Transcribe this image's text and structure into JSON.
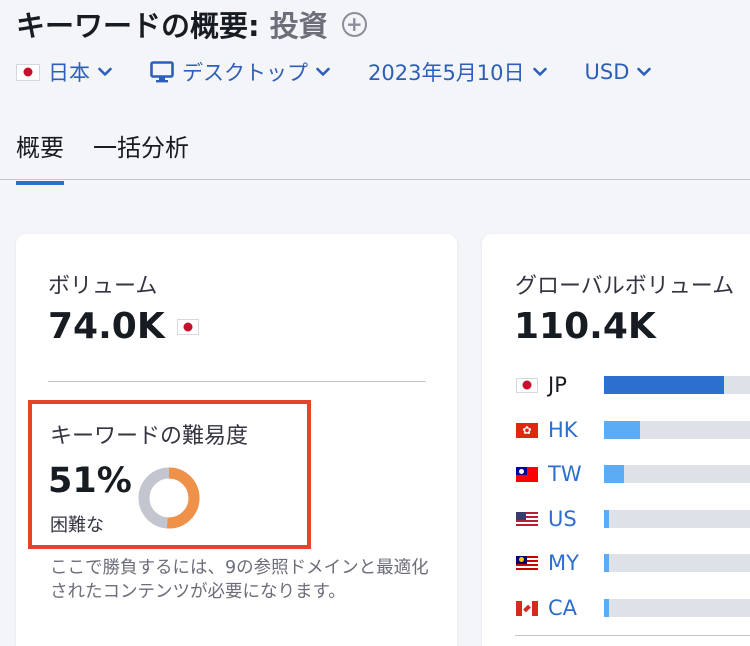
{
  "header": {
    "title_prefix": "キーワードの概要:",
    "keyword": "投資"
  },
  "filters": {
    "database": "日本",
    "device": "デスクトップ",
    "date": "2023年5月10日",
    "currency": "USD"
  },
  "tabs": [
    {
      "label": "概要",
      "active": true
    },
    {
      "label": "一括分析",
      "active": false
    }
  ],
  "volume": {
    "label": "ボリューム",
    "value": "74.0K"
  },
  "difficulty": {
    "label": "キーワードの難易度",
    "value": "51%",
    "percent": 51,
    "rating": "困難な",
    "description": "ここで勝負するには、9の参照ドメインと最適化されたコンテンツが必要になります。"
  },
  "global_volume": {
    "label": "グローバルボリューム",
    "value": "110.4K",
    "countries": [
      {
        "code": "JP",
        "share": 0.8,
        "color": "#2d6fce"
      },
      {
        "code": "HK",
        "share": 0.24,
        "color": "#5cacf5"
      },
      {
        "code": "TW",
        "share": 0.13,
        "color": "#5cacf5"
      },
      {
        "code": "US",
        "share": 0.03,
        "color": "#5cacf5"
      },
      {
        "code": "MY",
        "share": 0.03,
        "color": "#5cacf5"
      },
      {
        "code": "CA",
        "share": 0.03,
        "color": "#5cacf5"
      }
    ]
  },
  "colors": {
    "accent": "#2d6fce",
    "difficulty": "#f0914a",
    "highlight": "#e5432a"
  }
}
